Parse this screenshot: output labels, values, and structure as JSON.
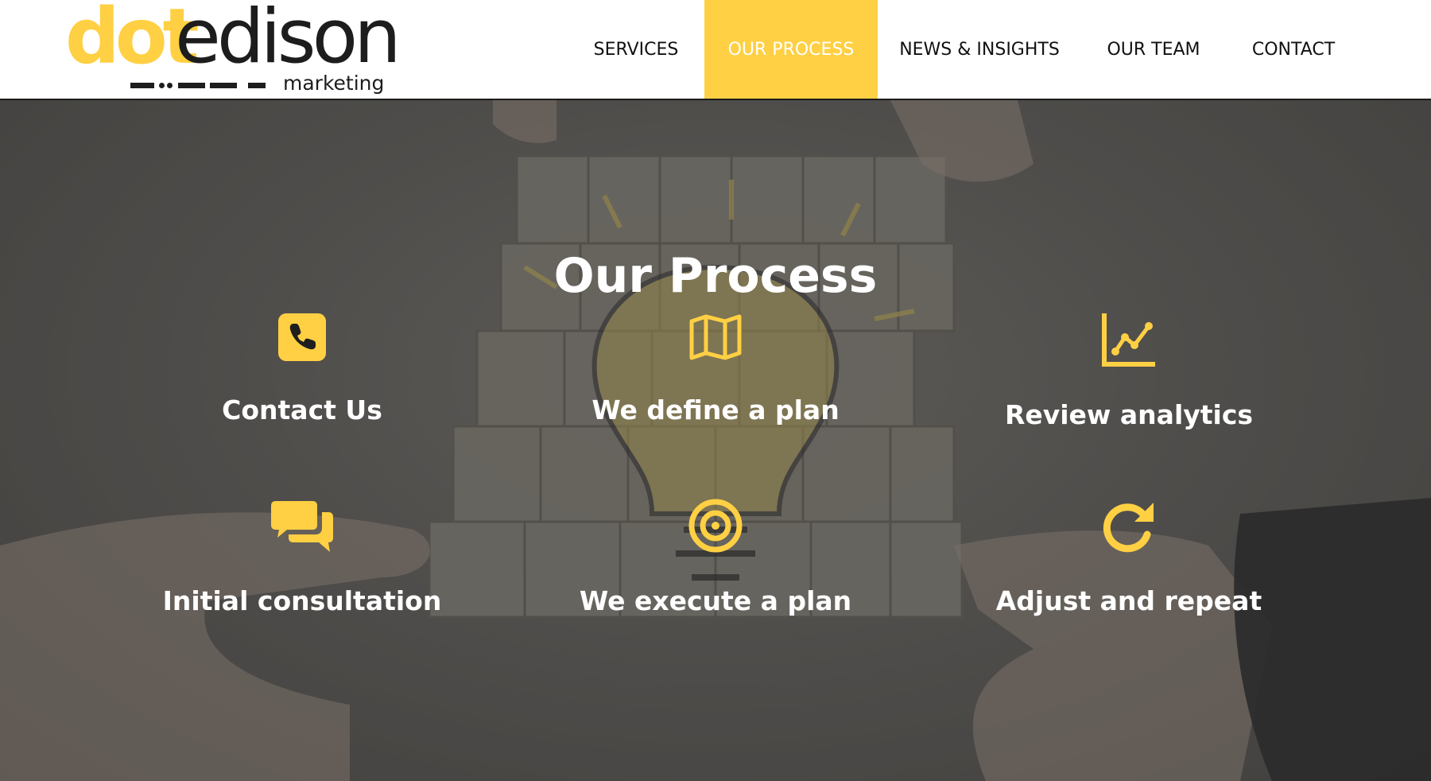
{
  "brand": {
    "logo_dot": "dot",
    "logo_edison": "edison",
    "logo_sub": "marketing",
    "accent_color": "#ffd043",
    "text_dark": "#1d1d1d"
  },
  "nav": {
    "items": [
      {
        "label": "SERVICES",
        "active": false
      },
      {
        "label": "OUR PROCESS",
        "active": true
      },
      {
        "label": "NEWS & INSIGHTS",
        "active": false
      },
      {
        "label": "OUR TEAM",
        "active": false
      },
      {
        "label": "CONTACT",
        "active": false
      }
    ]
  },
  "process": {
    "title": "Our Process",
    "steps": [
      {
        "label": "Contact Us",
        "icon": "phone-icon"
      },
      {
        "label": "We define a plan",
        "icon": "map-icon"
      },
      {
        "label": "Review analytics",
        "icon": "line-chart-icon"
      },
      {
        "label": "Initial consultation",
        "icon": "comments-icon"
      },
      {
        "label": "We execute a plan",
        "icon": "target-icon"
      },
      {
        "label": "Adjust and repeat",
        "icon": "redo-icon"
      }
    ]
  }
}
